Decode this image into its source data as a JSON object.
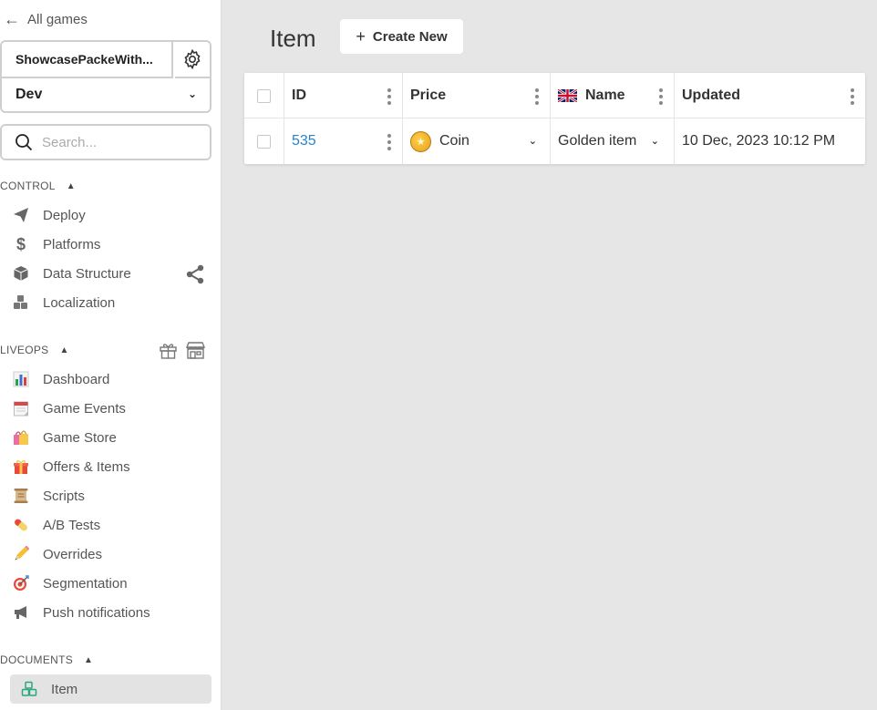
{
  "sidebar": {
    "back_label": "All games",
    "game_name": "ShowcasePackeWith...",
    "environment": "Dev",
    "search_placeholder": "Search...",
    "sections": {
      "control": {
        "label": "CONTROL",
        "items": [
          {
            "label": "Deploy",
            "icon": "paper-plane-icon"
          },
          {
            "label": "Platforms",
            "icon": "dollar-icon"
          },
          {
            "label": "Data Structure",
            "icon": "cube-icon"
          },
          {
            "label": "Localization",
            "icon": "cubes-icon"
          }
        ]
      },
      "liveops": {
        "label": "LIVEOPS",
        "items": [
          {
            "label": "Dashboard",
            "icon": "bar-chart-icon"
          },
          {
            "label": "Game Events",
            "icon": "calendar-icon"
          },
          {
            "label": "Game Store",
            "icon": "shopping-bags-icon"
          },
          {
            "label": "Offers & Items",
            "icon": "gift-icon"
          },
          {
            "label": "Scripts",
            "icon": "scroll-icon"
          },
          {
            "label": "A/B Tests",
            "icon": "pill-icon"
          },
          {
            "label": "Overrides",
            "icon": "pencil-icon"
          },
          {
            "label": "Segmentation",
            "icon": "target-icon"
          },
          {
            "label": "Push notifications",
            "icon": "megaphone-icon"
          }
        ]
      },
      "documents": {
        "label": "DOCUMENTS",
        "items": [
          {
            "label": "Item",
            "icon": "cubes-icon",
            "active": true
          }
        ]
      }
    }
  },
  "main": {
    "title": "Item",
    "create_label": "Create New",
    "table": {
      "columns": [
        "ID",
        "Price",
        "Name",
        "Updated"
      ],
      "rows": [
        {
          "id": "535",
          "price": "Coin",
          "name": "Golden item",
          "updated": "10 Dec, 2023 10:12 PM"
        }
      ]
    }
  },
  "colors": {
    "accent_link": "#2a82c9",
    "background": "#e6e6e6",
    "active_item": "#e3e3e3"
  }
}
